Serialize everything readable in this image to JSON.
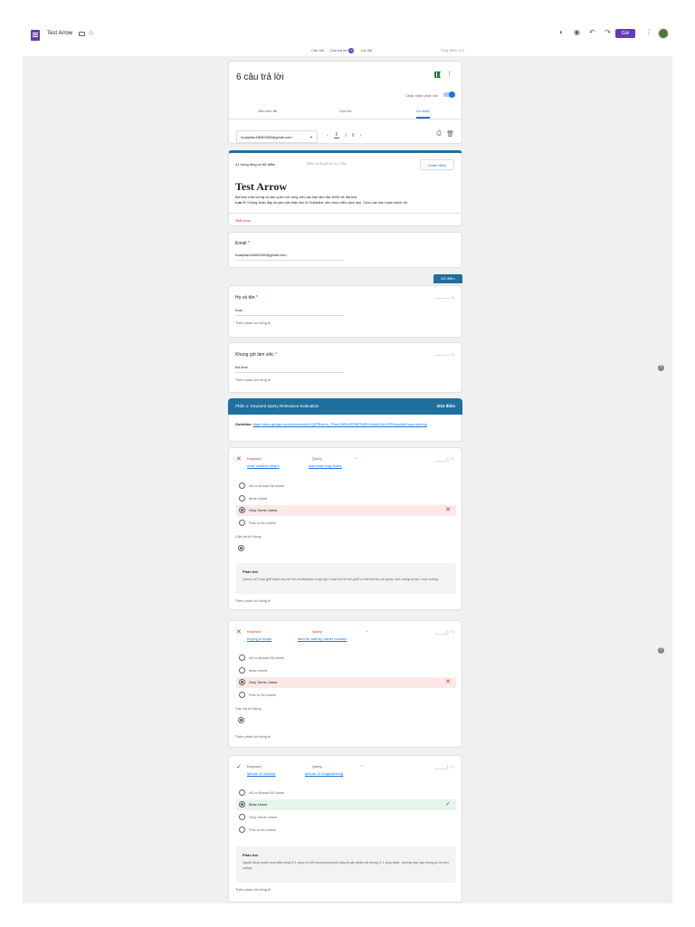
{
  "app": {
    "doc_title": "Test Arrow",
    "send_label": "Gửi",
    "tabs": [
      {
        "label": "Câu hỏi"
      },
      {
        "label": "Câu trả lời",
        "badge": "6"
      },
      {
        "label": "Cài đặt"
      }
    ],
    "total_score": "Tổng điểm: 6/6"
  },
  "summary": {
    "title": "6 câu trả lời",
    "accepting_label": "Chấp nhận phản hồi",
    "sub_tabs": [
      "Bản tóm tắt",
      "Câu hỏi",
      "Cá nhân"
    ],
    "respondent_email": "hoaiphan18082000@gmail.com",
    "page_current": "6",
    "page_sep": "/",
    "page_total": "6"
  },
  "form": {
    "score_line": "41 trong tổng số 66 điểm",
    "released_line": "Điểm số đã gửi lúc 8:27 PM",
    "rescore_label": "Chấm điểm",
    "title": "Test Arrow",
    "desc_line1": "Bài test chất lượng và làm quen với công việc,các bạn làm đạt 40/60 sẽ đạt test",
    "desc_bold": "Lưu Ý:",
    "desc_line2": "Không đoán đáp án,làm cẩn thận đọc kĩ Guideline nếu chưa hiểu cách làm. Chúc các bạn hoàn thành tốt",
    "required_note": "*Bắt buộc"
  },
  "email_q": {
    "label": "Email",
    "required": "*",
    "answer": "hoaiphan18082000@gmail.com"
  },
  "points_badge": "0/0 điểm",
  "name_q": {
    "label": "Họ và tên",
    "required": "*",
    "answer": "hoai",
    "feedback": "Thêm phản hồi riêng lẻ",
    "score": "/ 0"
  },
  "shift_q": {
    "label": "Khung giờ làm việc",
    "required": "*",
    "answer": "full time",
    "feedback": "Thêm phản hồi riêng lẻ",
    "score": "/ 0"
  },
  "section": {
    "title": "Phần 1: Keyword Query Relevance Evaluation",
    "points": "4/10 điểm",
    "guideline_label": "Guideline:",
    "guideline_url": "https://docs.google.com/document/d/1QZPRzvHn_7RanSNRfJNPR8PR6RXVAmUGM-0SPHksc/edit?usp=sharing"
  },
  "questions": [
    {
      "result": "wrong",
      "keyword_head": "Keyword",
      "query_head": "Query",
      "required": "*",
      "keyword": "chair children chairs",
      "query": "kids bean bag chairs",
      "score_value": "0",
      "score_total": "/ 1",
      "options": [
        "All or Almost All Users",
        "Most Users",
        "Only Some Users",
        "Few or No Users"
      ],
      "selected": 2,
      "correct_label": "Câu trả lời đúng",
      "explanation_title": "Phản hồi",
      "explanation": "Query chỉ 1 loại ghế dành cho trẻ em,và keyword cung cấp 1 loại chứ trẻ em ghế cụ thể hơn so với query nên chúng ta hạ 1 mức xuống.",
      "feedback": "Thêm phản hồi riêng lẻ"
    },
    {
      "result": "wrong",
      "keyword_head": "Keyword",
      "query_head": "Query",
      "required": "*",
      "keyword": "buying a house",
      "query": "land for sale by owner houston",
      "score_value": "0",
      "score_total": "/ 1",
      "options": [
        "All or Almost All Users",
        "Most Users",
        "Only Some Users",
        "Few or No Users"
      ],
      "selected": 2,
      "correct_label": "Câu trả lời đúng",
      "feedback": "Thêm phản hồi riêng lẻ"
    },
    {
      "result": "right",
      "keyword_head": "Keyword",
      "query_head": "Query",
      "required": "*",
      "keyword": "iphone 11 fptshop",
      "query": "iphone 11 thegioididong",
      "score_value": "1",
      "score_total": "/ 1",
      "options": [
        "All or Almost All Users",
        "Most Users",
        "Only Some Users",
        "Few or No Users"
      ],
      "selected": 1,
      "explanation_title": "Phản hồi",
      "explanation": "Người dùng muốn mua điện thoại ở 1 shop cụ thể nhưng keyword cũng là sản phẩm đó nhưng ở 1 shop khác, trường hợp này chúng ta hạ mức xuống.",
      "feedback": "Thêm phản hồi riêng lẻ"
    }
  ],
  "icons": {
    "accent": "#673ab7",
    "section_color": "#1f6f9f",
    "wrong_color": "#d93025",
    "right_color": "#188038"
  }
}
